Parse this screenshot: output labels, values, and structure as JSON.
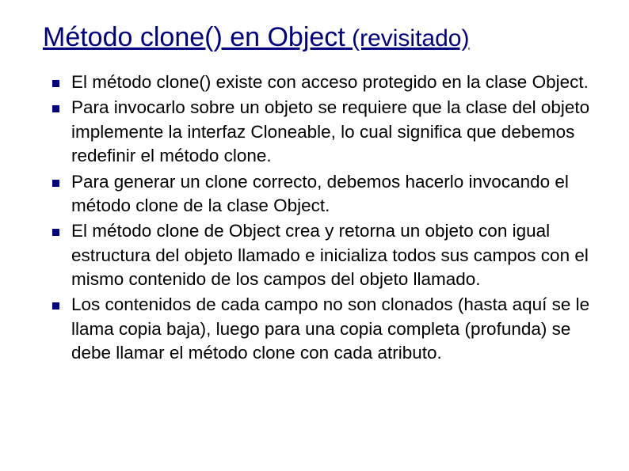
{
  "slide": {
    "title_main": "Método clone() en Object",
    "title_sub": " (revisitado)",
    "bullets": [
      "El método clone() existe con acceso protegido en la clase Object.",
      "Para invocarlo sobre un objeto se requiere que la clase del objeto implemente la interfaz Cloneable, lo cual significa que debemos redefinir el método clone.",
      "Para generar un clone correcto, debemos hacerlo invocando el método clone de la clase Object.",
      "El método clone de Object crea y retorna un objeto con igual estructura del objeto llamado e inicializa todos sus campos con el mismo contenido de los campos del objeto llamado.",
      "Los contenidos de cada campo no son clonados (hasta aquí se le llama copia baja), luego para una copia completa (profunda) se debe llamar el método clone con cada atributo."
    ]
  }
}
